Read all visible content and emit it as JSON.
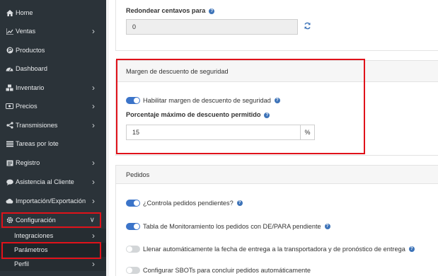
{
  "sidebar": {
    "items": [
      {
        "label": "Home",
        "icon": "home-icon",
        "has_chevron": false
      },
      {
        "label": "Ventas",
        "icon": "chart-icon",
        "has_chevron": true
      },
      {
        "label": "Productos",
        "icon": "product-icon",
        "has_chevron": false
      },
      {
        "label": "Dashboard",
        "icon": "dashboard-icon",
        "has_chevron": false
      },
      {
        "label": "Inventario",
        "icon": "inventory-icon",
        "has_chevron": true
      },
      {
        "label": "Precios",
        "icon": "price-icon",
        "has_chevron": true
      },
      {
        "label": "Transmisiones",
        "icon": "share-icon",
        "has_chevron": true
      },
      {
        "label": "Tareas por lote",
        "icon": "tasks-icon",
        "has_chevron": false
      },
      {
        "label": "Registro",
        "icon": "register-icon",
        "has_chevron": true
      },
      {
        "label": "Asistencia al Cliente",
        "icon": "chat-icon",
        "has_chevron": true
      },
      {
        "label": "Importación/Exportación",
        "icon": "cloud-icon",
        "has_chevron": true
      },
      {
        "label": "Configuración",
        "icon": "gear-icon",
        "has_chevron": true
      }
    ],
    "sub_items": [
      {
        "label": "Integraciones",
        "has_chevron": true
      },
      {
        "label": "Parámetros",
        "has_chevron": false
      },
      {
        "label": "Perfil",
        "has_chevron": true
      }
    ]
  },
  "rounding": {
    "label": "Redondear centavos para",
    "value": "0"
  },
  "discount_margin": {
    "title": "Margen de descuento de seguridad",
    "enable_label": "Habilitar margen de descuento de seguridad",
    "enabled": true,
    "max_label": "Porcentaje máximo de descuento permitido",
    "max_value": "15",
    "unit": "%"
  },
  "orders": {
    "title": "Pedidos",
    "toggles": [
      {
        "label": "¿Controla pedidos pendientes?",
        "on": true,
        "help": true
      },
      {
        "label": "Tabla de Monitoramiento los pedidos con DE/PARA pendiente",
        "on": true,
        "help": true
      },
      {
        "label": "Llenar automáticamente la fecha de entrega a la transportadora y de pronóstico de entrega",
        "on": false,
        "help": true
      },
      {
        "label": "Configurar SBOTs para concluir pedidos automáticamente",
        "on": false,
        "help": false
      }
    ]
  },
  "colors": {
    "sidebar_bg": "#2b3339",
    "accent": "#3b74c9",
    "highlight": "#e0121a"
  }
}
